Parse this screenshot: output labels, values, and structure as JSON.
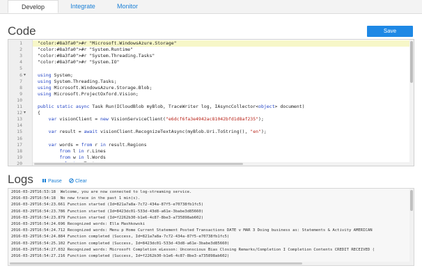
{
  "tabs": [
    {
      "label": "Develop",
      "active": true
    },
    {
      "label": "Integrate",
      "active": false
    },
    {
      "label": "Monitor",
      "active": false
    }
  ],
  "code_heading": "Code",
  "save_label": "Save",
  "editor": {
    "lines": [
      "#r \"Microsoft.WindowsAzure.Storage\"",
      "#r \"System.Runtime\"",
      "#r \"System.Threading.Tasks\"",
      "#r \"System.IO\"",
      "",
      "using System;",
      "using System.Threading.Tasks;",
      "using Microsoft.WindowsAzure.Storage.Blob;",
      "using Microsoft.ProjectOxford.Vision;",
      "",
      "public static async Task Run(ICloudBlob myBlob, TraceWriter log, IAsyncCollector<object> document)",
      "{",
      "    var visionClient = new VisionServiceClient(\"e6dcf6fa3e4942ac81042bfd1d8af235\");",
      "",
      "    var result = await visionClient.RecognizeTextAsync(myBlob.Uri.ToString(), \"en\");",
      "",
      "    var words = from r in result.Regions",
      "        from l in r.Lines",
      "        from w in l.Words",
      "        select w.Text;"
    ],
    "line_numbers": [
      "1",
      "2",
      "3",
      "4",
      "5",
      "6",
      "7",
      "8",
      "9",
      "10",
      "11",
      "12",
      "13",
      "14",
      "15",
      "16",
      "17",
      "18",
      "19",
      "20"
    ]
  },
  "logs": {
    "heading": "Logs",
    "pause_label": "Pause",
    "clear_label": "Clear",
    "lines": [
      "2016-03-29T16:53:18  Welcome, you are now connected to log-streaming service.",
      "2016-03-29T16:54:18  No new trace in the past 1 min(s).",
      "2016-03-29T16:54:23.661 Function started (Id=821a7a8a-7c72-434a-87f5-e70738fb1fc5)",
      "2016-03-29T16:54:23.786 Function started (Id=8423dc01-533d-43d8-a61e-3babe3d85660)",
      "2016-03-29T16:54:23.879 Function started (Id=f2262b30-b1e6-4c87-8be3-a735898ab602)",
      "2016-03-29T16:54:24.696 Recognized words: Ella Mashkowski",
      "2016-03-29T16:54:24.712 Recognized words: Menu p Home Current Statement Posted Transactions DATE v MAR 3 Doing business as: Statements & Activity AMERICAN",
      "2016-03-29T16:54:24.884 Function completed (Success, Id=821a7a8a-7c72-434a-87f5-e70738fb1fc5)",
      "2016-03-29T16:54:25.102 Function completed (Success, Id=8423dc01-533d-43d8-a61e-3babe3d85660)",
      "2016-03-29T16:54:27.032 Recognized words: Microsoft Completion eLesson: Unconscious Bias Closing Remarks/Completion I Completion Contents CREDIT RECEIVED (",
      "2016-03-29T16:54:27.216 Function completed (Success, Id=f2262b30-b1e6-4c87-8be3-a735898ab602)"
    ]
  },
  "colors": {
    "accent": "#1e88e5",
    "link": "#1a7fd6",
    "keyword": "#1d3fc4",
    "string": "#b8241a",
    "directive": "#8a3fa0"
  }
}
